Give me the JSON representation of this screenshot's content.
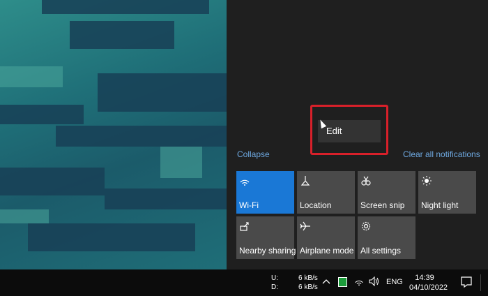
{
  "action_center": {
    "context_menu": {
      "edit_label": "Edit"
    },
    "collapse_label": "Collapse",
    "clear_all_label": "Clear all notifications",
    "tiles": [
      {
        "label": "Wi-Fi",
        "icon": "wifi-icon",
        "active": true
      },
      {
        "label": "Location",
        "icon": "location-icon",
        "active": false
      },
      {
        "label": "Screen snip",
        "icon": "screen-snip-icon",
        "active": false
      },
      {
        "label": "Night light",
        "icon": "night-light-icon",
        "active": false
      },
      {
        "label": "Nearby sharing",
        "icon": "nearby-sharing-icon",
        "active": false
      },
      {
        "label": "Airplane mode",
        "icon": "airplane-icon",
        "active": false
      },
      {
        "label": "All settings",
        "icon": "gear-icon",
        "active": false
      }
    ]
  },
  "taskbar": {
    "network": {
      "upload_label": "U:",
      "download_label": "D:",
      "upload_value": "6 kB/s",
      "download_value": "6 kB/s"
    },
    "language": "ENG",
    "time": "14:39",
    "date": "04/10/2022"
  },
  "colors": {
    "accent": "#1a78d6",
    "highlight_box": "#d8202a",
    "link": "#6ea8e0"
  }
}
